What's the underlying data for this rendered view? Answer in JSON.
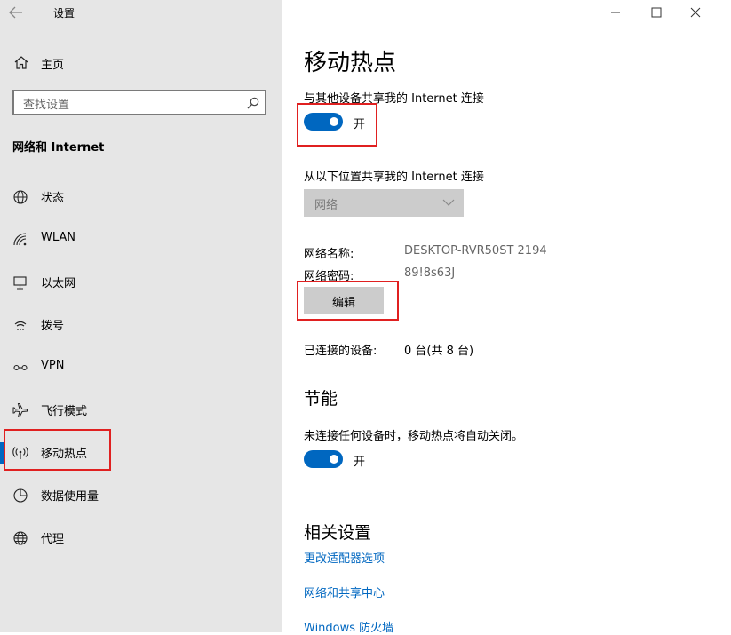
{
  "app": {
    "title": "设置"
  },
  "sidebar": {
    "home_label": "主页",
    "search_placeholder": "查找设置",
    "group_heading": "网络和 Internet",
    "items": [
      {
        "label": "状态",
        "icon": "globe-status-icon"
      },
      {
        "label": "WLAN",
        "icon": "wifi-icon"
      },
      {
        "label": "以太网",
        "icon": "ethernet-icon"
      },
      {
        "label": "拨号",
        "icon": "dialup-icon"
      },
      {
        "label": "VPN",
        "icon": "vpn-icon"
      },
      {
        "label": "飞行模式",
        "icon": "airplane-icon"
      },
      {
        "label": "移动热点",
        "icon": "hotspot-icon",
        "selected": true
      },
      {
        "label": "数据使用量",
        "icon": "data-usage-icon"
      },
      {
        "label": "代理",
        "icon": "globe-icon"
      }
    ]
  },
  "main": {
    "page_title": "移动热点",
    "share_label": "与其他设备共享我的 Internet 连接",
    "share_toggle": {
      "state": "开",
      "on": true
    },
    "share_from_label": "从以下位置共享我的 Internet 连接",
    "share_from_value": "网络",
    "network_name_label": "网络名称:",
    "network_name_value": "DESKTOP-RVR50ST 2194",
    "network_password_label": "网络密码:",
    "network_password_value": "89!8s63J",
    "edit_button": "编辑",
    "connected_label": "已连接的设备:",
    "connected_value": "0 台(共 8 台)",
    "power_heading": "节能",
    "power_label": "未连接任何设备时，移动热点将自动关闭。",
    "power_toggle": {
      "state": "开",
      "on": true
    },
    "related_heading": "相关设置",
    "links": [
      "更改适配器选项",
      "网络和共享中心",
      "Windows 防火墙"
    ]
  },
  "colors": {
    "accent": "#0067c0",
    "sidebar_bg": "#e6e6e6",
    "highlight_box": "#e02020"
  }
}
